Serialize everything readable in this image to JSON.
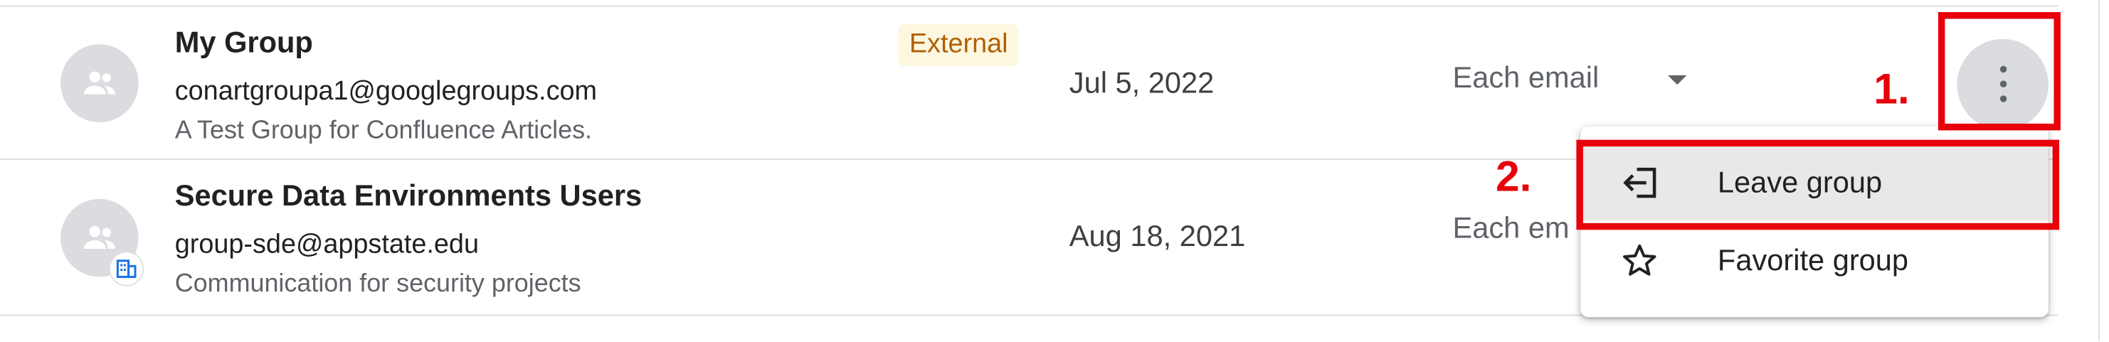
{
  "groups": [
    {
      "name": "My Group",
      "email": "conartgroupa1@googlegroups.com",
      "description": "A Test Group for Confluence Articles.",
      "chip": "External",
      "joined": "Jul 5, 2022",
      "subscription": "Each email"
    },
    {
      "name": "Secure Data Environments Users",
      "email": "group-sde@appstate.edu",
      "description": "Communication for security projects",
      "joined": "Aug 18, 2021",
      "subscription": "Each em"
    }
  ],
  "menu": {
    "items": [
      {
        "label": "Leave group",
        "icon": "leave-icon"
      },
      {
        "label": "Favorite group",
        "icon": "star-outline-icon"
      }
    ]
  },
  "annotations": {
    "step1": "1.",
    "step2": "2.",
    "color": "#e8000b"
  }
}
